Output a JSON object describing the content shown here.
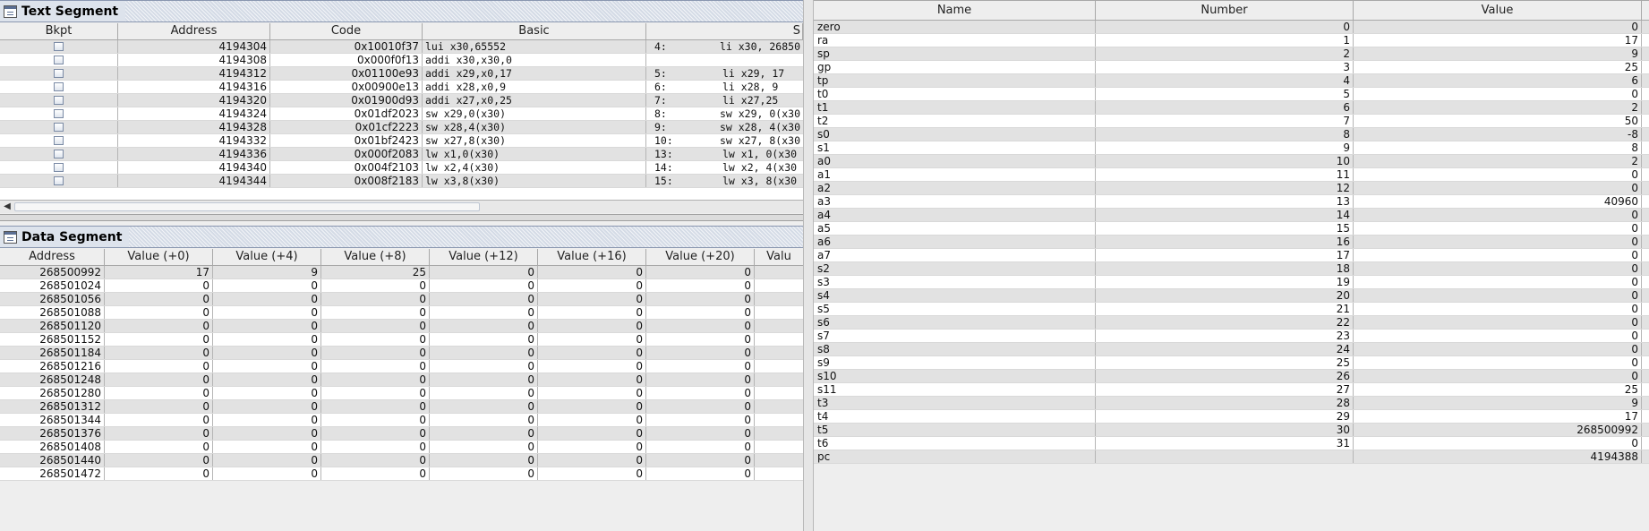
{
  "text_segment": {
    "title": "Text Segment",
    "columns": [
      "Bkpt",
      "Address",
      "Code",
      "Basic",
      "S"
    ],
    "rows": [
      {
        "address": "4194304",
        "code": "0x10010f37",
        "basic": "lui x30,65552",
        "line": "4:",
        "source": "li x30, 26850"
      },
      {
        "address": "4194308",
        "code": "0x000f0f13",
        "basic": "addi x30,x30,0",
        "line": "",
        "source": ""
      },
      {
        "address": "4194312",
        "code": "0x01100e93",
        "basic": "addi x29,x0,17",
        "line": "5:",
        "source": "li x29, 17"
      },
      {
        "address": "4194316",
        "code": "0x00900e13",
        "basic": "addi x28,x0,9",
        "line": "6:",
        "source": "li x28, 9"
      },
      {
        "address": "4194320",
        "code": "0x01900d93",
        "basic": "addi x27,x0,25",
        "line": "7:",
        "source": "li x27,25"
      },
      {
        "address": "4194324",
        "code": "0x01df2023",
        "basic": "sw x29,0(x30)",
        "line": "8:",
        "source": "sw x29, 0(x30"
      },
      {
        "address": "4194328",
        "code": "0x01cf2223",
        "basic": "sw x28,4(x30)",
        "line": "9:",
        "source": "sw x28, 4(x30"
      },
      {
        "address": "4194332",
        "code": "0x01bf2423",
        "basic": "sw x27,8(x30)",
        "line": "10:",
        "source": "sw x27, 8(x30"
      },
      {
        "address": "4194336",
        "code": "0x000f2083",
        "basic": "lw x1,0(x30)",
        "line": "13:",
        "source": "lw x1, 0(x30"
      },
      {
        "address": "4194340",
        "code": "0x004f2103",
        "basic": "lw x2,4(x30)",
        "line": "14:",
        "source": "lw x2, 4(x30"
      },
      {
        "address": "4194344",
        "code": "0x008f2183",
        "basic": "lw x3,8(x30)",
        "line": "15:",
        "source": "lw x3, 8(x30"
      }
    ]
  },
  "data_segment": {
    "title": "Data Segment",
    "columns": [
      "Address",
      "Value (+0)",
      "Value (+4)",
      "Value (+8)",
      "Value (+12)",
      "Value (+16)",
      "Value (+20)",
      "Valu"
    ],
    "rows": [
      {
        "address": "268500992",
        "values": [
          "17",
          "9",
          "25",
          "0",
          "0",
          "0"
        ]
      },
      {
        "address": "268501024",
        "values": [
          "0",
          "0",
          "0",
          "0",
          "0",
          "0"
        ]
      },
      {
        "address": "268501056",
        "values": [
          "0",
          "0",
          "0",
          "0",
          "0",
          "0"
        ]
      },
      {
        "address": "268501088",
        "values": [
          "0",
          "0",
          "0",
          "0",
          "0",
          "0"
        ]
      },
      {
        "address": "268501120",
        "values": [
          "0",
          "0",
          "0",
          "0",
          "0",
          "0"
        ]
      },
      {
        "address": "268501152",
        "values": [
          "0",
          "0",
          "0",
          "0",
          "0",
          "0"
        ]
      },
      {
        "address": "268501184",
        "values": [
          "0",
          "0",
          "0",
          "0",
          "0",
          "0"
        ]
      },
      {
        "address": "268501216",
        "values": [
          "0",
          "0",
          "0",
          "0",
          "0",
          "0"
        ]
      },
      {
        "address": "268501248",
        "values": [
          "0",
          "0",
          "0",
          "0",
          "0",
          "0"
        ]
      },
      {
        "address": "268501280",
        "values": [
          "0",
          "0",
          "0",
          "0",
          "0",
          "0"
        ]
      },
      {
        "address": "268501312",
        "values": [
          "0",
          "0",
          "0",
          "0",
          "0",
          "0"
        ]
      },
      {
        "address": "268501344",
        "values": [
          "0",
          "0",
          "0",
          "0",
          "0",
          "0"
        ]
      },
      {
        "address": "268501376",
        "values": [
          "0",
          "0",
          "0",
          "0",
          "0",
          "0"
        ]
      },
      {
        "address": "268501408",
        "values": [
          "0",
          "0",
          "0",
          "0",
          "0",
          "0"
        ]
      },
      {
        "address": "268501440",
        "values": [
          "0",
          "0",
          "0",
          "0",
          "0",
          "0"
        ]
      },
      {
        "address": "268501472",
        "values": [
          "0",
          "0",
          "0",
          "0",
          "0",
          "0"
        ]
      }
    ]
  },
  "registers": {
    "columns": [
      "Name",
      "Number",
      "Value"
    ],
    "rows": [
      {
        "name": "zero",
        "number": "0",
        "value": "0"
      },
      {
        "name": "ra",
        "number": "1",
        "value": "17"
      },
      {
        "name": "sp",
        "number": "2",
        "value": "9"
      },
      {
        "name": "gp",
        "number": "3",
        "value": "25"
      },
      {
        "name": "tp",
        "number": "4",
        "value": "6"
      },
      {
        "name": "t0",
        "number": "5",
        "value": "0"
      },
      {
        "name": "t1",
        "number": "6",
        "value": "2"
      },
      {
        "name": "t2",
        "number": "7",
        "value": "50"
      },
      {
        "name": "s0",
        "number": "8",
        "value": "-8"
      },
      {
        "name": "s1",
        "number": "9",
        "value": "8"
      },
      {
        "name": "a0",
        "number": "10",
        "value": "2"
      },
      {
        "name": "a1",
        "number": "11",
        "value": "0"
      },
      {
        "name": "a2",
        "number": "12",
        "value": "0"
      },
      {
        "name": "a3",
        "number": "13",
        "value": "40960"
      },
      {
        "name": "a4",
        "number": "14",
        "value": "0"
      },
      {
        "name": "a5",
        "number": "15",
        "value": "0"
      },
      {
        "name": "a6",
        "number": "16",
        "value": "0"
      },
      {
        "name": "a7",
        "number": "17",
        "value": "0"
      },
      {
        "name": "s2",
        "number": "18",
        "value": "0"
      },
      {
        "name": "s3",
        "number": "19",
        "value": "0"
      },
      {
        "name": "s4",
        "number": "20",
        "value": "0"
      },
      {
        "name": "s5",
        "number": "21",
        "value": "0"
      },
      {
        "name": "s6",
        "number": "22",
        "value": "0"
      },
      {
        "name": "s7",
        "number": "23",
        "value": "0"
      },
      {
        "name": "s8",
        "number": "24",
        "value": "0"
      },
      {
        "name": "s9",
        "number": "25",
        "value": "0"
      },
      {
        "name": "s10",
        "number": "26",
        "value": "0"
      },
      {
        "name": "s11",
        "number": "27",
        "value": "25"
      },
      {
        "name": "t3",
        "number": "28",
        "value": "9"
      },
      {
        "name": "t4",
        "number": "29",
        "value": "17"
      },
      {
        "name": "t5",
        "number": "30",
        "value": "268500992"
      },
      {
        "name": "t6",
        "number": "31",
        "value": "0"
      },
      {
        "name": "pc",
        "number": "",
        "value": "4194388"
      }
    ]
  },
  "icons": {
    "window_icon": "window-icon",
    "scroll_left": "scroll-left-arrow-icon",
    "scroll_left_glyph": "◀"
  }
}
